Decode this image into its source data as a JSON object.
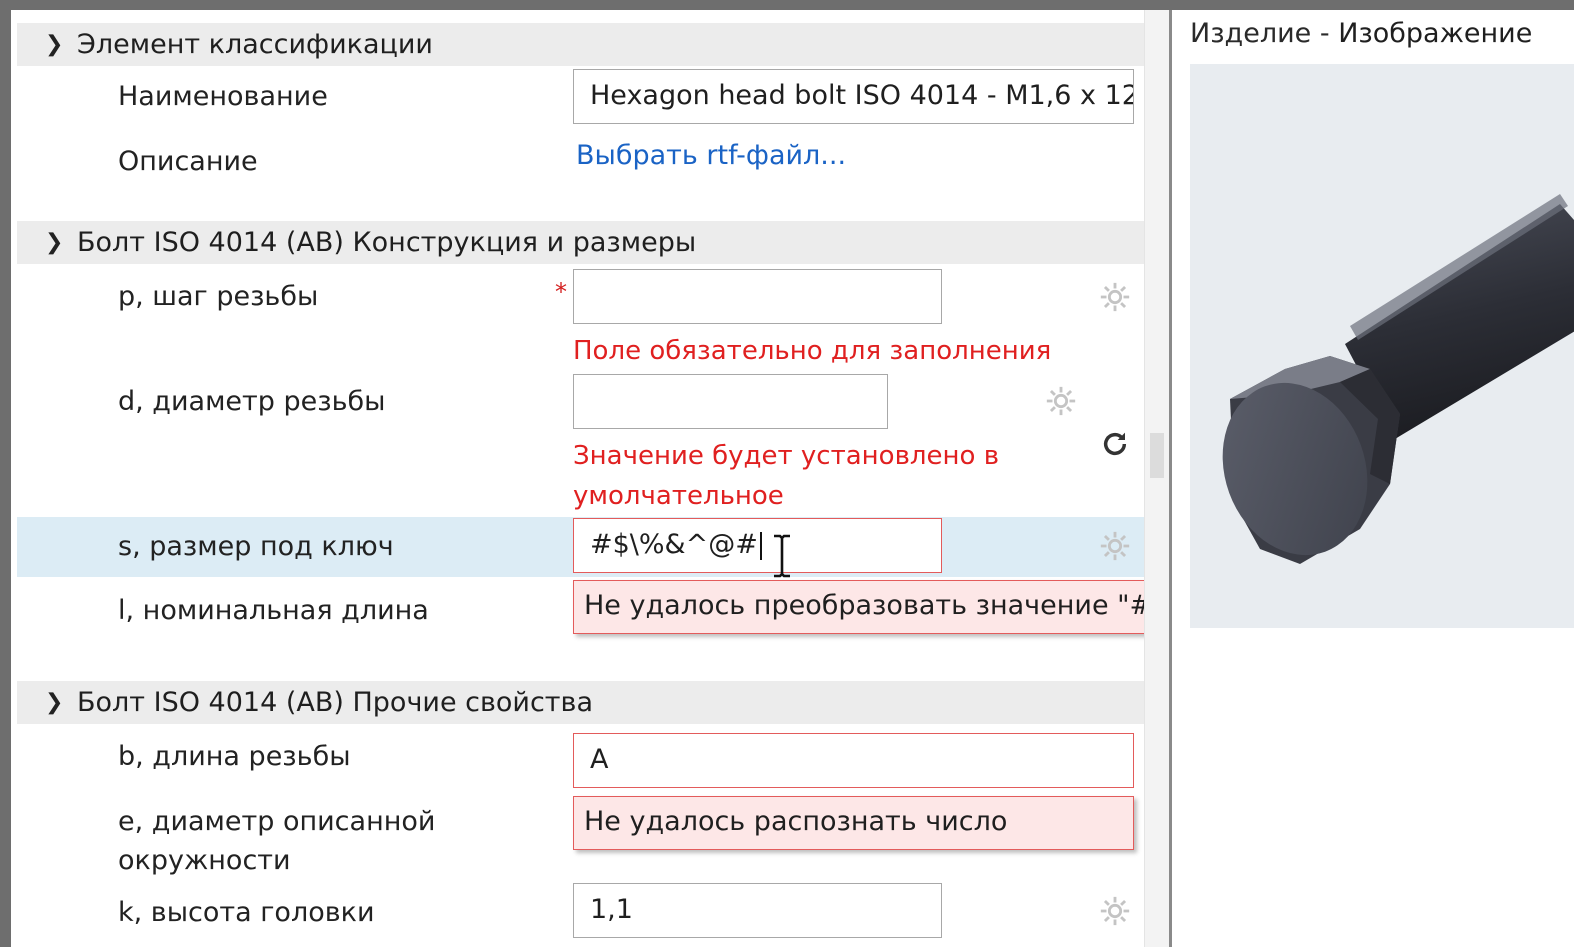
{
  "sections": [
    {
      "id": "classification",
      "title": "Элемент классификации"
    },
    {
      "id": "construction",
      "title": "Болт ISO 4014 (AB) Конструкция и размеры"
    },
    {
      "id": "other",
      "title": "Болт ISO 4014 (AB) Прочие свойства"
    }
  ],
  "classification": {
    "name_label": "Наименование",
    "name_value": "Hexagon head bolt ISO 4014 - M1,6 x 12",
    "description_label": "Описание",
    "description_link": "Выбрать rtf-файл..."
  },
  "construction": {
    "p_label": "p, шаг резьбы",
    "p_required": "*",
    "p_value": "",
    "p_error": "Поле обязательно для заполнения",
    "d_label": "d, диаметр резьбы",
    "d_value": "",
    "d_error_line1": "Значение будет установлено в",
    "d_error_line2": "умолчательное",
    "s_label": "s, размер под ключ",
    "s_value": "#$\\%&^@#",
    "s_tooltip": "Не удалось преобразовать значение \"#$\\%&^@#\".",
    "l_label": "l, номинальная длина"
  },
  "other": {
    "b_label": "b, длина резьбы",
    "b_value": "A",
    "b_tooltip": "Не удалось распознать число",
    "e_label_line1": "e, диаметр описанной",
    "e_label_line2": "окружности",
    "k_label": "k, высота головки",
    "k_value": "1,1"
  },
  "right_panel": {
    "title": "Изделие",
    "separator": "-",
    "subtitle": "Изображение"
  },
  "icons": {
    "gear": "gear-icon",
    "refresh": "refresh-icon",
    "chevron": "chevron-down-icon",
    "text_cursor": "ibeam-cursor-icon"
  },
  "colors": {
    "section_bg": "#ececec",
    "highlight_row": "#dcecf5",
    "error_red": "#e02020",
    "link_blue": "#1a63c5",
    "tooltip_bg": "#fde7e7",
    "tooltip_border": "#e35b5b"
  }
}
